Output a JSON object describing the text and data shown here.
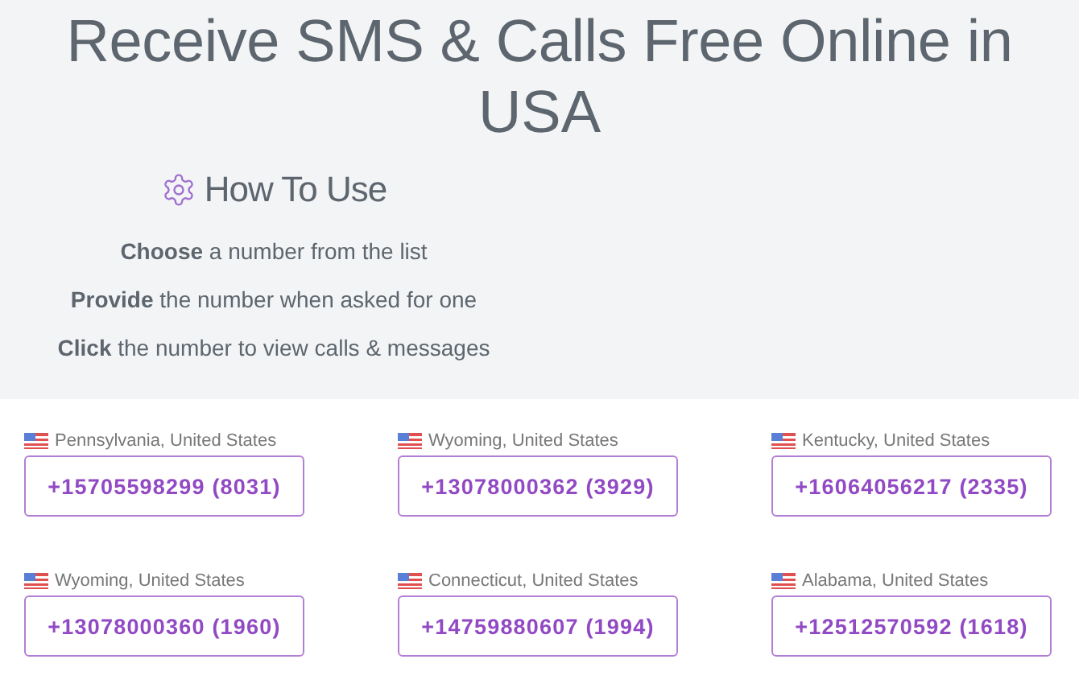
{
  "heading": {
    "title": "Receive SMS & Calls Free Online in",
    "country": "USA"
  },
  "how_to_use": {
    "title": "How To Use",
    "steps": [
      "**Choose** a number from the list",
      "**Provide** the number when asked for one",
      "**Click** the number to view calls & messages"
    ]
  },
  "numbers": [
    {
      "location": "Pennsylvania, United States",
      "number": "+15705598299 (8031)"
    },
    {
      "location": "Wyoming, United States",
      "number": "+13078000362 (3929)"
    },
    {
      "location": "Kentucky, United States",
      "number": "+16064056217 (2335)"
    },
    {
      "location": "Wyoming, United States",
      "number": "+13078000360 (1960)"
    },
    {
      "location": "Connecticut, United States",
      "number": "+14759880607 (1994)"
    },
    {
      "location": "Alabama, United States",
      "number": "+12512570592 (1618)"
    }
  ]
}
